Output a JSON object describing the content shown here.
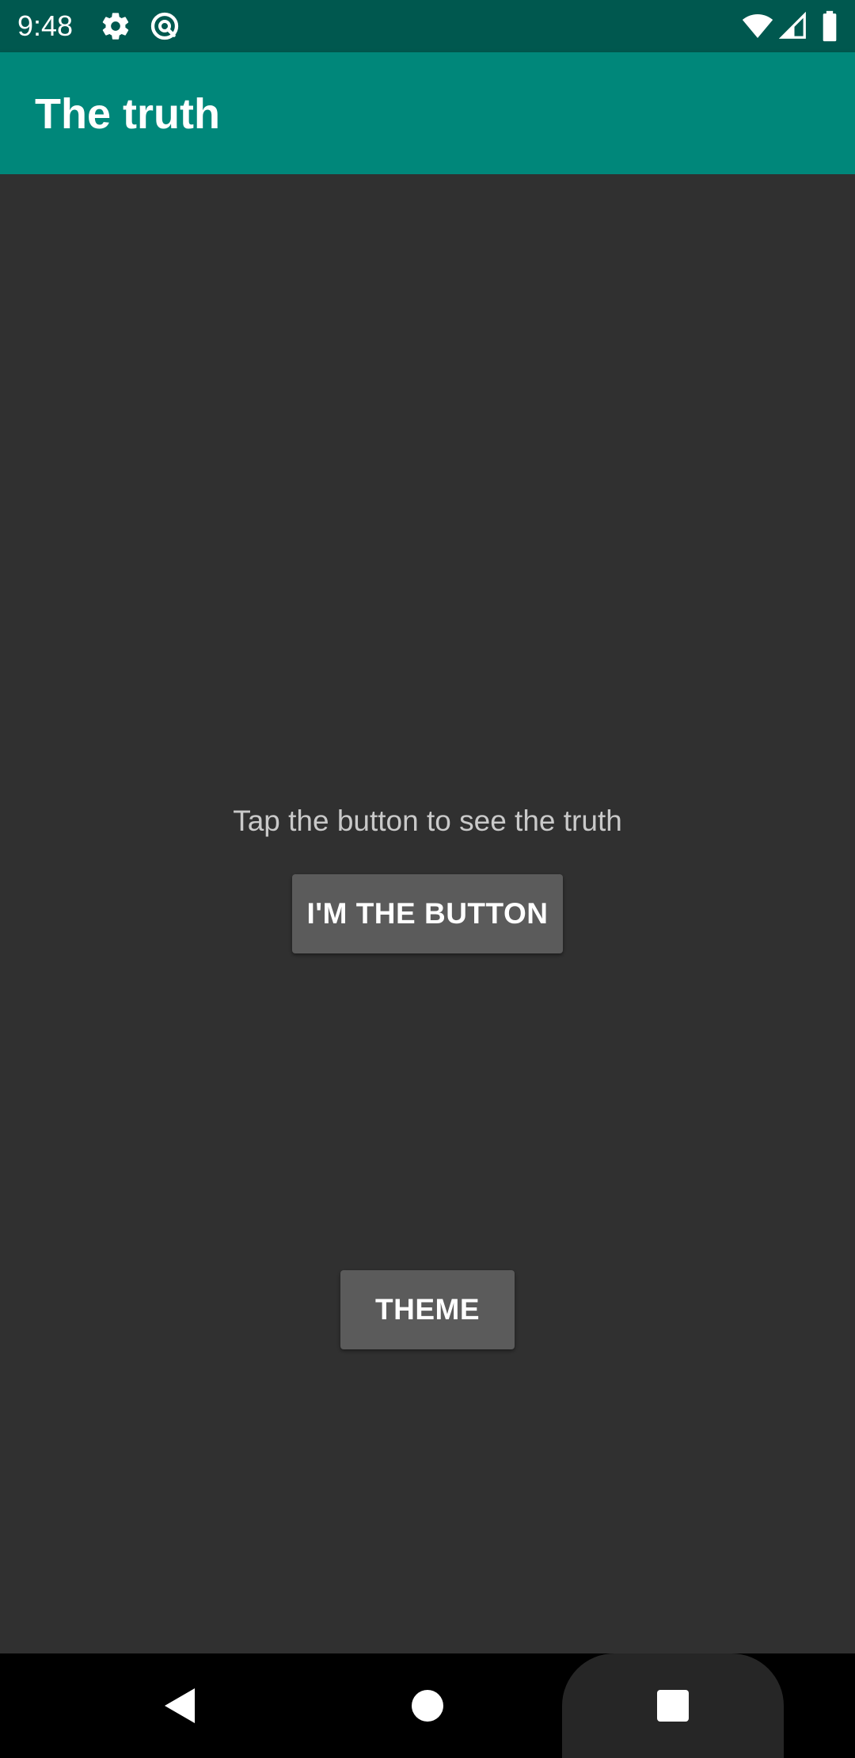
{
  "status_bar": {
    "time": "9:48",
    "icons_left": [
      "gear-icon",
      "sync-icon"
    ],
    "icons_right": [
      "wifi-icon",
      "signal-icon",
      "battery-icon"
    ]
  },
  "app_bar": {
    "title": "The truth",
    "color": "#00877a"
  },
  "main": {
    "prompt": "Tap the button to see the truth",
    "truth_button_label": "I'M THE BUTTON",
    "theme_button_label": "THEME"
  },
  "nav_bar": {
    "items": [
      "back-icon",
      "home-icon",
      "recents-icon"
    ]
  },
  "colors": {
    "status_bar": "#00584f",
    "background": "#303030",
    "button": "#5b5b5b",
    "prompt_text": "#c9c9c9"
  }
}
